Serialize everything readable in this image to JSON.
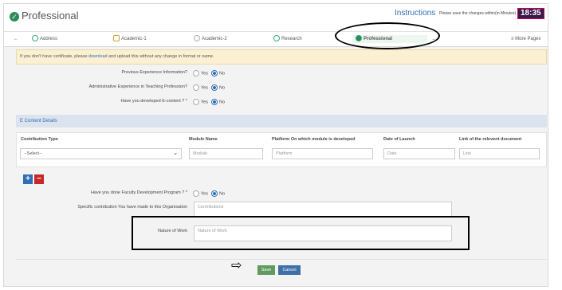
{
  "header": {
    "title": "Professional",
    "instructions": "Instructions",
    "save_note": "Please save the changes within(in Minutes)",
    "timer": "18:35"
  },
  "tabs": [
    {
      "label": "Address"
    },
    {
      "label": "Academic-1"
    },
    {
      "label": "Academic-2"
    },
    {
      "label": "Research"
    },
    {
      "label": "Professional"
    }
  ],
  "more_pages": "≡ More Pages",
  "notice": {
    "before": "If you don't have certificate, please ",
    "link": "download",
    "after": " and upload this without any change in format or name."
  },
  "questions": {
    "prev_exp": "Previous Experience Information?",
    "admin_exp": "Administrative Experience in Teaching Profession?",
    "econtent": "Have you developed E-content ? *",
    "fdp": "Have you done Faculty Development Program ? *",
    "yes": "Yes",
    "no": "No"
  },
  "econtent_section": {
    "title": "E Content Details",
    "columns": [
      "Contribution Type",
      "Module Name",
      "Platform On which module is developed",
      "Date of Launch",
      "Link of the relevent document"
    ],
    "select_value": "--Select--",
    "placeholders": {
      "module": "Module",
      "platform": "Platform",
      "date": "Date",
      "link": "Link"
    }
  },
  "contribution": {
    "label": "Specific contribution You have made to this Organisation",
    "placeholder": "Contributions"
  },
  "nature": {
    "label": "Nature of Work",
    "placeholder": "Nature of Work"
  },
  "buttons": {
    "save": "Save",
    "cancel": "Cancel"
  },
  "colors": {
    "accent": "#2f6fb5",
    "save": "#5f9a5f",
    "cancel": "#3f6fa8",
    "add": "#2f6fb5",
    "remove": "#c62828"
  }
}
